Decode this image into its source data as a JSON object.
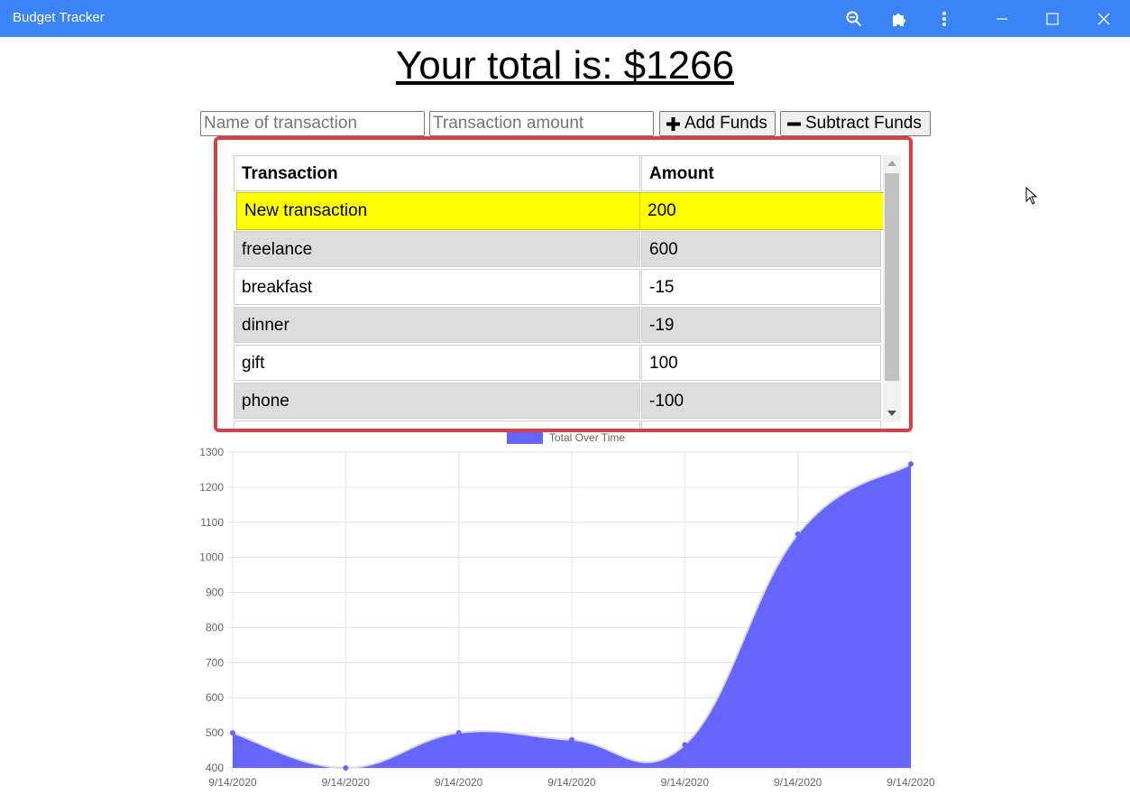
{
  "window": {
    "title": "Budget Tracker"
  },
  "toolbar_icons": [
    "zoom-icon",
    "extensions-icon",
    "more-icon",
    "minimize-icon",
    "maximize-icon",
    "close-icon"
  ],
  "total": {
    "text": "Your total is: $1266"
  },
  "form": {
    "name_placeholder": "Name of transaction",
    "amount_placeholder": "Transaction amount",
    "add_label": "Add Funds",
    "subtract_label": "Subtract Funds"
  },
  "table": {
    "headers": {
      "name": "Transaction",
      "amount": "Amount"
    },
    "rows": [
      {
        "name": "New transaction",
        "amount": "200"
      },
      {
        "name": "freelance",
        "amount": "600"
      },
      {
        "name": "breakfast",
        "amount": "-15"
      },
      {
        "name": "dinner",
        "amount": "-19"
      },
      {
        "name": "gift",
        "amount": "100"
      },
      {
        "name": "phone",
        "amount": "-100"
      }
    ]
  },
  "colors": {
    "titlebar": "#3b84f5",
    "highlight": "#ffff00",
    "table_border": "#db3e45",
    "area_fill": "#6666ff"
  },
  "chart_data": {
    "type": "area",
    "legend": "Total Over Time",
    "legend_position": "top",
    "x": [
      "9/14/2020",
      "9/14/2020",
      "9/14/2020",
      "9/14/2020",
      "9/14/2020",
      "9/14/2020",
      "9/14/2020"
    ],
    "series": [
      {
        "name": "Total Over Time",
        "values": [
          500,
          400,
          500,
          480,
          466,
          1066,
          1266
        ]
      }
    ],
    "y_ticks": [
      "1300",
      "1200",
      "1100",
      "1000",
      "900",
      "800",
      "700",
      "600",
      "500",
      "400"
    ],
    "ylim": [
      400,
      1300
    ],
    "grid": true
  }
}
